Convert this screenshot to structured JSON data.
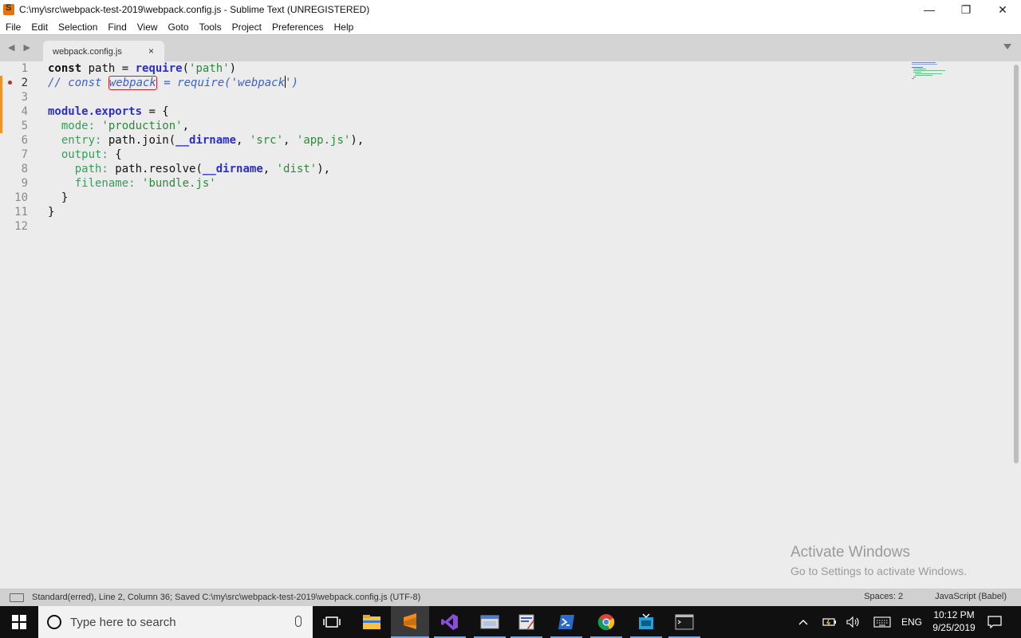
{
  "window": {
    "title": "C:\\my\\src\\webpack-test-2019\\webpack.config.js - Sublime Text (UNREGISTERED)",
    "controls": {
      "minimize": "—",
      "maximize": "❐",
      "close": "✕"
    }
  },
  "menu": {
    "items": [
      "File",
      "Edit",
      "Selection",
      "Find",
      "View",
      "Goto",
      "Tools",
      "Project",
      "Preferences",
      "Help"
    ]
  },
  "tabs": {
    "nav": "◀ ▶",
    "active": {
      "label": "webpack.config.js",
      "close": "×"
    }
  },
  "editor": {
    "line_numbers": [
      "1",
      "2",
      "3",
      "4",
      "5",
      "6",
      "7",
      "8",
      "9",
      "10",
      "11",
      "12"
    ],
    "current_line": 2,
    "error_marker_line": 2,
    "lines": {
      "l1": {
        "kw": "const",
        "a": " path = ",
        "fn": "require",
        "b": "(",
        "str": "'path'",
        "c": ")"
      },
      "l2": {
        "a": "// const ",
        "err": "webpack",
        "b": " = require('webpack",
        "c": "')"
      },
      "l4": {
        "kw": "module.exports",
        "a": " = {"
      },
      "l5": {
        "indent": "  ",
        "prop": "mode:",
        "a": " ",
        "str": "'production'",
        "b": ","
      },
      "l6": {
        "indent": "  ",
        "prop": "entry:",
        "a": " path.join(",
        "magic": "__dirname",
        "b": ", ",
        "s1": "'src'",
        "c": ", ",
        "s2": "'app.js'",
        "d": "),"
      },
      "l7": {
        "indent": "  ",
        "prop": "output:",
        "a": " {"
      },
      "l8": {
        "indent": "    ",
        "prop": "path:",
        "a": " path.resolve(",
        "magic": "__dirname",
        "b": ", ",
        "s1": "'dist'",
        "c": "),"
      },
      "l9": {
        "indent": "    ",
        "prop": "filename:",
        "a": " ",
        "str": "'bundle.js'"
      },
      "l10": {
        "a": "  }"
      },
      "l11": {
        "a": "}"
      }
    },
    "colors": {
      "keyword": "#111111",
      "function": "#2c2ec8",
      "string": "#2a8a3a",
      "comment": "#3a62c9",
      "error_box": "#d02020",
      "modified_gutter": "#f0922a"
    }
  },
  "watermark": {
    "title": "Activate Windows",
    "subtitle": "Go to Settings to activate Windows."
  },
  "status": {
    "left": "Standard(erred), Line 2, Column 36; Saved C:\\my\\src\\webpack-test-2019\\webpack.config.js (UTF-8)",
    "spaces": "Spaces: 2",
    "syntax": "JavaScript (Babel)"
  },
  "taskbar": {
    "search_placeholder": "Type here to search",
    "language": "ENG",
    "time": "10:12 PM",
    "date": "9/25/2019"
  }
}
